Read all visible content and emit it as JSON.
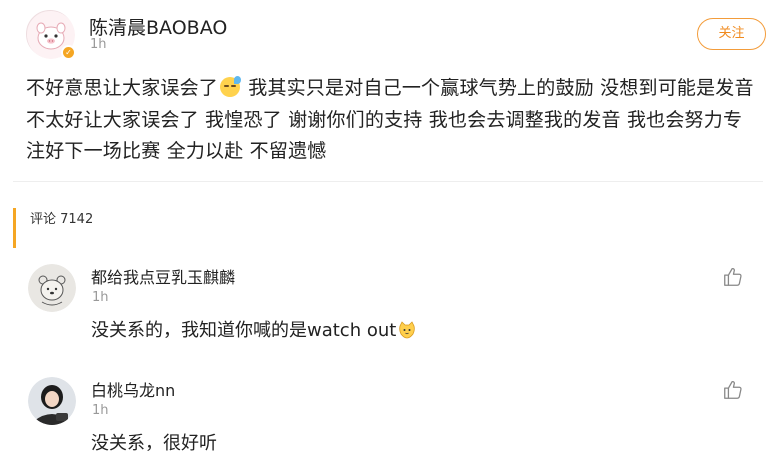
{
  "post": {
    "author": "陈清晨BAOBAO",
    "time": "1h",
    "follow_label": "关注",
    "text_before_emoji": "不好意思让大家误会了",
    "emoji": "sleepy-sweat-emoji",
    "text_after_emoji": " 我其实只是对自己一个赢球气势上的鼓励 没想到可能是发音不太好让大家误会了 我惶恐了 谢谢你们的支持 我也会去调整我的发音 我也会努力专注好下一场比赛 全力以赴 不留遗憾"
  },
  "comments_section": {
    "label": "评论 7142",
    "accent_color": "#f5a623"
  },
  "comments": [
    {
      "name": "都给我点豆乳玉麒麟",
      "time": "1h",
      "text": "没关系的，我知道你喊的是watch out",
      "emoji": "cat-emoji",
      "like_icon": "thumbs-up-icon"
    },
    {
      "name": "白桃乌龙nn",
      "time": "1h",
      "text": "没关系，很好听",
      "like_icon": "thumbs-up-icon"
    }
  ],
  "colors": {
    "follow_border": "#f39c3a",
    "follow_text": "#f08a1e",
    "verified_badge": "#f5a623"
  }
}
